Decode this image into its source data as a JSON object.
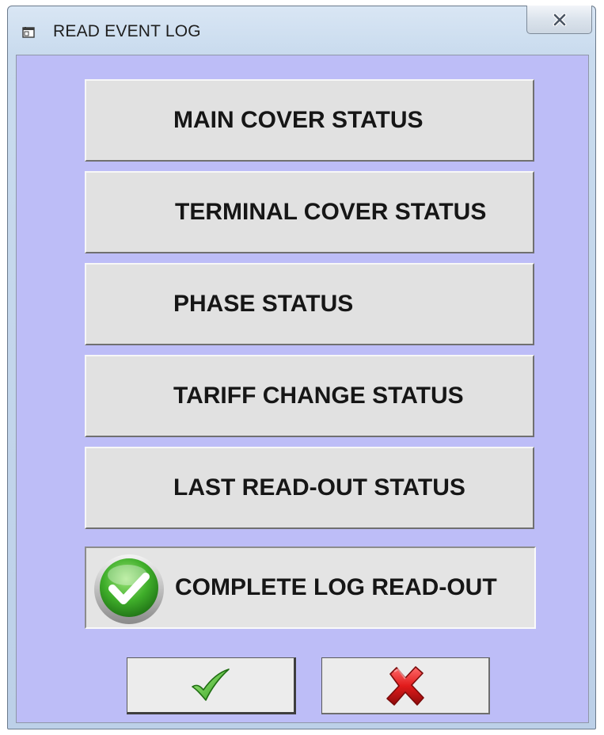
{
  "window": {
    "title": "READ EVENT LOG",
    "title_icon": "window-app-icon",
    "close_icon": "close-x-icon"
  },
  "buttons": {
    "main_cover": "MAIN COVER STATUS",
    "terminal_cover": "TERMINAL COVER STATUS",
    "phase": "PHASE STATUS",
    "tariff_change": "TARIFF CHANGE STATUS",
    "last_readout": "LAST READ-OUT STATUS",
    "complete_log": "COMPLETE LOG READ-OUT",
    "complete_log_icon": "green-check-circle-icon",
    "ok_icon": "green-checkmark-icon",
    "cancel_icon": "red-x-icon"
  },
  "colors": {
    "client_background": "#bdbdf7",
    "button_face": "#e1e1e1",
    "check_green": "#3fae2a",
    "cancel_red": "#d8161b"
  }
}
